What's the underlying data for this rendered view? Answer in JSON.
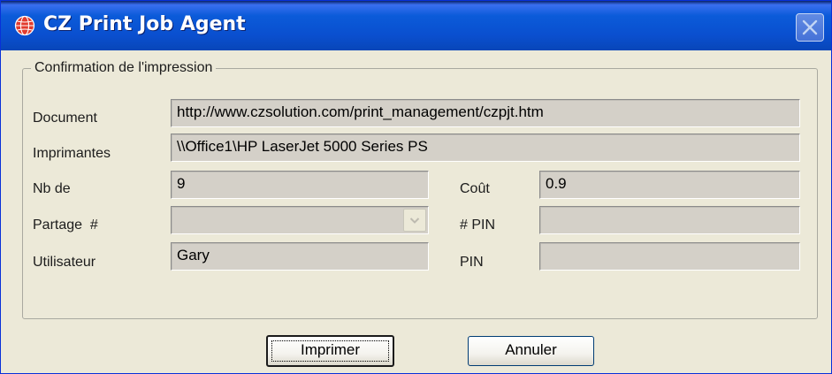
{
  "window": {
    "title": "CZ Print Job Agent",
    "title_icon": "globe-icon",
    "close_icon": "close-icon",
    "accent_color": "#0a4fcf"
  },
  "group": {
    "legend": "Confirmation de l'impression"
  },
  "fields": {
    "document": {
      "label": "Document",
      "value": "http://www.czsolution.com/print_management/czpjt.htm"
    },
    "imprimantes": {
      "label": "Imprimantes",
      "value": "\\\\Office1\\HP LaserJet 5000 Series PS"
    },
    "nb_de": {
      "label": "Nb de",
      "value": "9"
    },
    "cout": {
      "label": "Coût",
      "value": "0.9"
    },
    "partage": {
      "label": "Partage  #",
      "value": ""
    },
    "pin_number": {
      "label": "# PIN",
      "value": ""
    },
    "utilisateur": {
      "label": "Utilisateur",
      "value": "Gary"
    },
    "pin": {
      "label": "PIN",
      "value": ""
    }
  },
  "buttons": {
    "imprimer": "Imprimer",
    "annuler": "Annuler"
  }
}
